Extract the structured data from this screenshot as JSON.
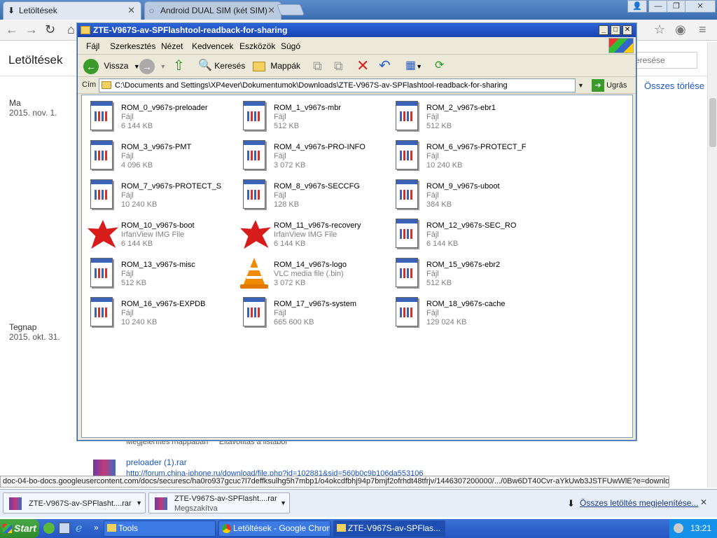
{
  "browser": {
    "tabs": [
      {
        "label": "Letöltések",
        "active": true
      },
      {
        "label": "Android DUAL SIM (két SIM)",
        "active": false
      }
    ]
  },
  "downloads_page": {
    "title": "Letöltések",
    "search_placeholder": "eresése",
    "clear_all": "Összes törlése",
    "groups": [
      {
        "day": "Ma",
        "date": "2015. nov. 1."
      },
      {
        "day": "Tegnap",
        "date": "2015. okt. 31."
      }
    ],
    "partial_row_text": "Megjelenítés mappában     Eltávolítás a listából",
    "partial_item_name": "preloader (1).rar",
    "partial_item_url": "http://forum.china-iphone.ru/download/file.php?id=102881&sid=560b0c9b106da553106"
  },
  "explorer": {
    "title": "ZTE-V967S-av-SPFlashtool-readback-for-sharing",
    "menu": [
      "Fájl",
      "Szerkesztés",
      "Nézet",
      "Kedvencek",
      "Eszközök",
      "Súgó"
    ],
    "toolbar": {
      "back": "Vissza",
      "search": "Keresés",
      "folders": "Mappák"
    },
    "address_label": "Cím",
    "address": "C:\\Documents and Settings\\XP4ever\\Dokumentumok\\Downloads\\ZTE-V967S-av-SPFlashtool-readback-for-sharing",
    "go": "Ugrás",
    "files": [
      {
        "name": "ROM_0_v967s-preloader",
        "type": "Fájl",
        "size": "6 144 KB",
        "icon": "generic-file-icon"
      },
      {
        "name": "ROM_1_v967s-mbr",
        "type": "Fájl",
        "size": "512 KB",
        "icon": "generic-file-icon"
      },
      {
        "name": "ROM_2_v967s-ebr1",
        "type": "Fájl",
        "size": "512 KB",
        "icon": "generic-file-icon"
      },
      {
        "name": "ROM_3_v967s-PMT",
        "type": "Fájl",
        "size": "4 096 KB",
        "icon": "generic-file-icon"
      },
      {
        "name": "ROM_4_v967s-PRO-INFO",
        "type": "Fájl",
        "size": "3 072 KB",
        "icon": "generic-file-icon"
      },
      {
        "name": "ROM_6_v967s-PROTECT_F",
        "type": "Fájl",
        "size": "10 240 KB",
        "icon": "generic-file-icon"
      },
      {
        "name": "ROM_7_v967s-PROTECT_S",
        "type": "Fájl",
        "size": "10 240 KB",
        "icon": "generic-file-icon"
      },
      {
        "name": "ROM_8_v967s-SECCFG",
        "type": "Fájl",
        "size": "128 KB",
        "icon": "generic-file-icon"
      },
      {
        "name": "ROM_9_v967s-uboot",
        "type": "Fájl",
        "size": "384 KB",
        "icon": "generic-file-icon"
      },
      {
        "name": "ROM_10_v967s-boot",
        "type": "IrfanView IMG File",
        "size": "6 144 KB",
        "icon": "irfanview-icon"
      },
      {
        "name": "ROM_11_v967s-recovery",
        "type": "IrfanView IMG File",
        "size": "6 144 KB",
        "icon": "irfanview-icon"
      },
      {
        "name": "ROM_12_v967s-SEC_RO",
        "type": "Fájl",
        "size": "6 144 KB",
        "icon": "generic-file-icon"
      },
      {
        "name": "ROM_13_v967s-misc",
        "type": "Fájl",
        "size": "512 KB",
        "icon": "generic-file-icon"
      },
      {
        "name": "ROM_14_v967s-logo",
        "type": "VLC media file (.bin)",
        "size": "3 072 KB",
        "icon": "vlc-icon"
      },
      {
        "name": "ROM_15_v967s-ebr2",
        "type": "Fájl",
        "size": "512 KB",
        "icon": "generic-file-icon"
      },
      {
        "name": "ROM_16_v967s-EXPDB",
        "type": "Fájl",
        "size": "10 240 KB",
        "icon": "generic-file-icon"
      },
      {
        "name": "ROM_17_v967s-system",
        "type": "Fájl",
        "size": "665 600 KB",
        "icon": "generic-file-icon"
      },
      {
        "name": "ROM_18_v967s-cache",
        "type": "Fájl",
        "size": "129 024 KB",
        "icon": "generic-file-icon"
      }
    ]
  },
  "status_url": "doc-04-bo-docs.googleusercontent.com/docs/securesc/ha0ro937gcuc7l7deffksulhg5h7mbp1/o4okcdfbhj94p7bmjf2ofrhdt48tfrjv/1446307200000/.../0Bw6DT40Cvr-aYkUwb3JSTFUwWlE?e=download",
  "download_bar": {
    "items": [
      {
        "name": "ZTE-V967S-av-SPFlasht....rar",
        "status": ""
      },
      {
        "name": "ZTE-V967S-av-SPFlasht....rar",
        "status": "Megszakítva"
      }
    ],
    "show_all": "Összes letöltés megjelenítése..."
  },
  "taskbar": {
    "start": "Start",
    "buttons": [
      {
        "label": "Tools",
        "active": false
      },
      {
        "label": "Letöltések - Google Chrome",
        "active": false
      },
      {
        "label": "ZTE-V967S-av-SPFlas...",
        "active": true
      }
    ],
    "time": "13:21"
  }
}
